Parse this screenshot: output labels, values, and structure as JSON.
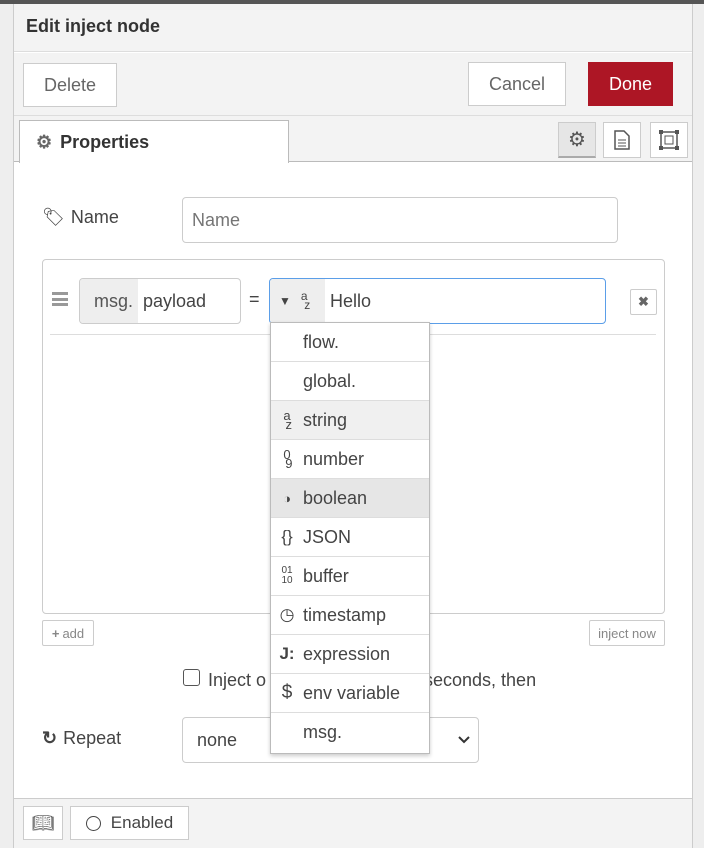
{
  "dialog": {
    "title": "Edit inject node"
  },
  "buttons": {
    "delete": "Delete",
    "cancel": "Cancel",
    "done": "Done"
  },
  "colors": {
    "done": "#ad1625",
    "focus_border": "#5b9ee8"
  },
  "tabs": [
    {
      "label": "Properties",
      "icon": "gear-icon"
    }
  ],
  "tab_icons": [
    "gear-icon",
    "document-icon",
    "frame-icon"
  ],
  "name_field": {
    "label": "Name",
    "placeholder": "Name",
    "value": ""
  },
  "property_row": {
    "prefix": "msg.",
    "property": "payload",
    "equals": "=",
    "type_icon": "az",
    "value": "Hello"
  },
  "type_menu": [
    {
      "icon": "",
      "label": "flow."
    },
    {
      "icon": "az",
      "label": "string"
    },
    {
      "icon": "09",
      "label": "number"
    },
    {
      "icon": "boolean",
      "label": "boolean"
    },
    {
      "icon": "{}",
      "label": "JSON"
    },
    {
      "icon": "0110",
      "label": "buffer"
    },
    {
      "icon": "clock",
      "label": "timestamp"
    },
    {
      "icon": "J:",
      "label": "expression"
    },
    {
      "icon": "$",
      "label": "env variable"
    },
    {
      "icon": "",
      "label": "msg."
    },
    {
      "icon": "",
      "label": "global."
    }
  ],
  "add_label": "add",
  "inject_now": "inject now",
  "inject_once": {
    "text_start": "Inject o",
    "text_end": "seconds, then",
    "checked": false
  },
  "repeat": {
    "label": "Repeat",
    "value": "none"
  },
  "footer": {
    "enabled": "Enabled"
  }
}
